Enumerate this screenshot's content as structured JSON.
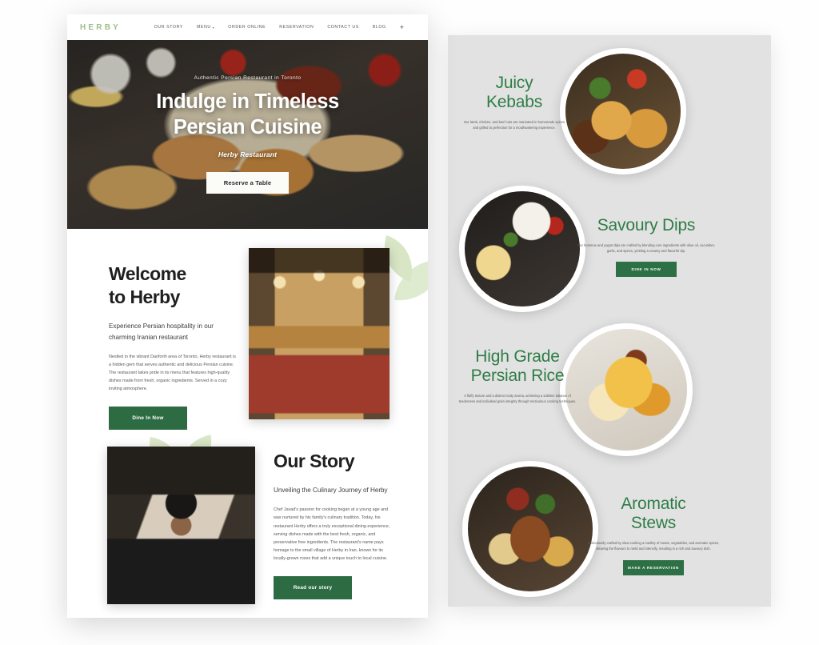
{
  "site": {
    "logo": "HERBY",
    "nav": [
      {
        "label": "OUR STORY",
        "caret": false
      },
      {
        "label": "MENU",
        "caret": true
      },
      {
        "label": "ORDER ONLINE",
        "caret": false
      },
      {
        "label": "RESERVATION",
        "caret": false
      },
      {
        "label": "CONTACT US",
        "caret": false
      },
      {
        "label": "BLOG",
        "caret": false
      }
    ],
    "nav_plus": "+"
  },
  "hero": {
    "eyebrow": "Authentic Persian Restaurant in Toronto",
    "title_line1": "Indulge in Timeless",
    "title_line2": "Persian Cuisine",
    "subtitle": "Herby Restaurant",
    "cta": "Reserve a Table"
  },
  "welcome": {
    "title_line1": "Welcome",
    "title_line2": "to Herby",
    "lead": "Experience Persian hospitality in our charming Iranian restaurant",
    "body": "Nestled in the vibrant Danforth area of Toronto, Herby restaurant is a hidden gem that serves authentic and delicious Persian cuisine. The restaurant takes pride in its menu that features high-quality dishes made from fresh, organic ingredients. Served in a cozy inviting atmosphere.",
    "cta": "Dine In Now"
  },
  "story": {
    "title": "Our Story",
    "lead": "Unveiling the Culinary Journey of Herby",
    "body": "Chef Javad's passion for cooking began at a young age and was nurtured by his family's culinary tradition. Today, his restaurant Herby offers a truly exceptional dining experience, serving dishes made with the best fresh, organic, and preservative free ingredients. The restaurant's name pays homage to the small village of Herby in Iran, known for its locally-grown roses that add a unique touch to local cuisine.",
    "cta": "Read our story"
  },
  "menu_sections": [
    {
      "title_line1": "Juicy",
      "title_line2": "Kebabs",
      "desc": "Our lamb, chicken, and beef cuts are marinated in homemade spices and grilled to perfection for a mouthwatering experience.",
      "cta": null
    },
    {
      "title_line1": "Savoury Dips",
      "title_line2": "",
      "desc": "Our hummus and yogurt dips are crafted by blending core ingredients with olive oil, cucumber, garlic, and spices, yielding a creamy and flavorful dip.",
      "cta": "DINE IN NOW"
    },
    {
      "title_line1": "High Grade",
      "title_line2": "Persian Rice",
      "desc": "A fluffy texture and a distinct nutty aroma, achieving a sublime balance of tenderness and individual grain integrity through meticulous cooking techniques.",
      "cta": null
    },
    {
      "title_line1": "Aromatic",
      "title_line2": "Stews",
      "desc": "Meticulously crafted by slow-cooking a medley of meats, vegetables, and aromatic spices, allowing the flavours to meld and intensify, resulting in a rich and savoury dish.",
      "cta": "MAKE A RESERVATION"
    }
  ],
  "colors": {
    "brand_green": "#2d6b43",
    "accent_green": "#2f7d46",
    "logo_green": "#9dbd86",
    "panel_grey": "#e2e2e2"
  }
}
